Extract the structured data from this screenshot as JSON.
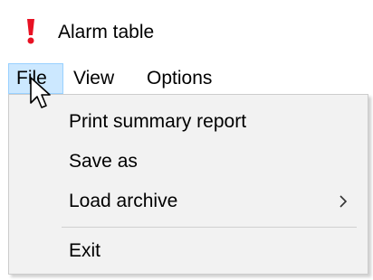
{
  "window": {
    "title": "Alarm table",
    "icon": "exclamation-icon",
    "icon_color": "#e81123"
  },
  "menubar": {
    "items": [
      {
        "label": "File",
        "active": true
      },
      {
        "label": "View"
      },
      {
        "label": "Options"
      }
    ]
  },
  "file_menu": {
    "items": [
      {
        "label": "Print summary report"
      },
      {
        "label": "Save as"
      },
      {
        "label": "Load archive",
        "has_submenu": true,
        "submenu_glyph": "›"
      },
      {
        "label": "Exit"
      }
    ]
  },
  "colors": {
    "menu_highlight_bg": "#cce8ff",
    "menu_highlight_border": "#99d1ff",
    "dropdown_bg": "#f2f2f2"
  }
}
